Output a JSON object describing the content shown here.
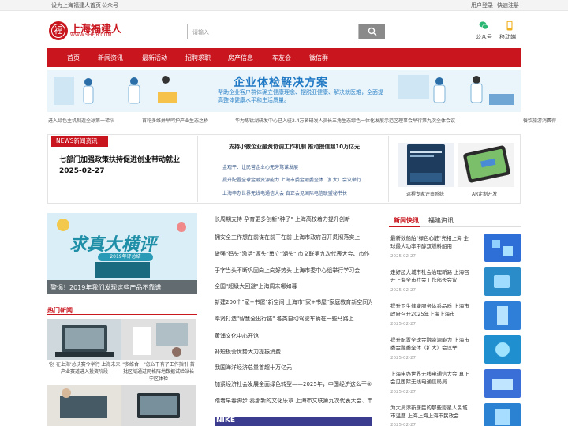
{
  "topbar": {
    "set_home": "设为上海福建人首页",
    "official": "公众号",
    "login": "用户登录",
    "quick_register": "快速注册"
  },
  "header": {
    "logo_name": "上海福建人",
    "logo_url": "WWW.SHFJR.COM",
    "logo_glyph": "福",
    "search_placeholder": "请输入",
    "wechat_label": "公众号",
    "mobile_label": "移动端",
    "search_icon": "search-icon",
    "wechat_icon": "wechat-icon",
    "mobile_icon": "mobile-icon"
  },
  "nav": [
    "首页",
    "新闻资讯",
    "最新活动",
    "招聘求职",
    "房产信息",
    "车友会",
    "微信群"
  ],
  "banner": {
    "title": "企业体检解决方案",
    "subtitle": "帮助企业客户群体确立健康理念、摆脱亚健康、解决就医难，全面提高整体健康水平和生活质量。"
  },
  "ticker": [
    "进入绿色主机制造全球第一梯队",
    "首轮多维并举呵护产业生态之桥",
    "华为炼钛湖研发中心已入驻2.4万名研发人员",
    "长三角生态绿色一体化发展示范区理事会举行第九次全体会议",
    "餐饮旅游消费得"
  ],
  "featured": {
    "tag": "NEWS新闻资讯",
    "headline": "七部门加强政策扶持促进创业带动就业",
    "date": "2025-02-27",
    "mid_title": "支持小微企业融资协调工作机制 推动授信超10万亿元",
    "mid_items": [
      "金观平：让民营企业心无旁骛谋发展",
      "提升配置全球金融资源能力 上海市委金融委全体（扩大）会议举行",
      "上海申办世界无线电通信大会 真正会见国际电信联盟秘书长"
    ],
    "thumbs": [
      {
        "caption": "远程专家评审系统"
      },
      {
        "caption": "AR定制开发"
      }
    ]
  },
  "promo": {
    "big_text": "求真大横评",
    "pill_text": "2019年评总结",
    "caption": "警惕！2019年我们发现这些产品不靠谱"
  },
  "hot_news": {
    "title": "热门新闻",
    "items": [
      {
        "caption": "'创·在上海'总决赛今举行 上海未来产业赛道进入投资阶段"
      },
      {
        "caption": "\"多维合一\"怎么干有了工作指引 首批区域通过网格阵地数据试验站长宁区体检"
      },
      {
        "caption": ""
      },
      {
        "caption": ""
      }
    ]
  },
  "middle_list": [
    {
      "text": "长周期支持 孕育更多创新\"种子\" 上海高校着力提升创新",
      "bold": true,
      "center": false
    },
    {
      "text": "拥安全工作想在前谋在前干在前 上海市政府召开贯彻落实上",
      "bold": false,
      "center": false
    },
    {
      "text": "做强\"码头\"激活\"源头\"勇立\"潮头\" 市文联第九次代表大会、市作",
      "bold": false,
      "center": false
    },
    {
      "text": "于字当头不断巩固向上向好势头 上海市委中心组举行学习会",
      "bold": false,
      "center": true
    },
    {
      "text": "全国\"超级大回避\"上海周末哪如暮",
      "bold": false,
      "center": true
    },
    {
      "text": "新建200个\"家+书屋\"新空间 上海市\"家+书屋\"家庭教育新空间为",
      "bold": false,
      "center": false
    },
    {
      "text": "奉贤打造\"智慧全出行链\" 各类自动驾驶车辆在一些马路上",
      "bold": true,
      "center": false
    },
    {
      "text": "黄浦文化中心开馆",
      "bold": false,
      "center": true
    },
    {
      "text": "补短板营优势大力提振消费",
      "bold": false,
      "center": true
    },
    {
      "text": "我国海洋经济总量首超十万亿元",
      "bold": false,
      "center": true
    },
    {
      "text": "加紧经济社会发展全面绿色转型——2025年，中国经济这么干⑤",
      "bold": false,
      "center": false
    },
    {
      "text": "踏着早春脚步 奏那新的文化乐章 上海市文联第九次代表大会、市",
      "bold": false,
      "center": false
    }
  ],
  "nike_label": "NIKE",
  "right_panel": {
    "tab_active": "新闻快讯",
    "tab_other": "福建资讯",
    "items": [
      {
        "text": "最新数船舶\"绿色心脏\"亮相上海 全球最大功率甲醇双燃料船用",
        "date": "2025-02-27"
      },
      {
        "text": "走好超大城市社会治理新路 上海召开上海全市社会工作部长会议",
        "date": "2025-02-27"
      },
      {
        "text": "提升卫生健康服务体系品质 上海市政府召开2025年上海上海市",
        "date": "2025-02-27"
      },
      {
        "text": "提升配置全球金融资源能力 上海市委金融委全体（扩大）会议举",
        "date": "2025-02-27"
      },
      {
        "text": "上海申办世界无线电通信大会 真正会见国际无线电通信局局",
        "date": "2025-02-27"
      },
      {
        "text": "为大局添新居民的那些影星人民城市温度 上海上海上海市民政会",
        "date": "2025-02-27"
      }
    ]
  }
}
